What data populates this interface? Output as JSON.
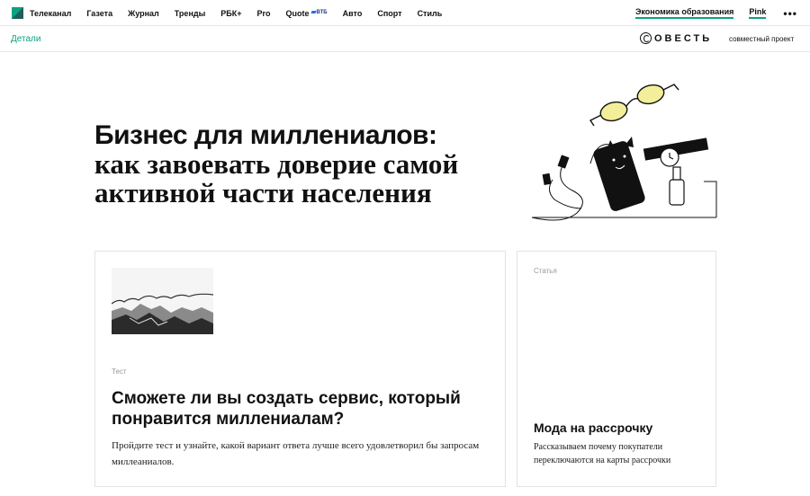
{
  "nav": {
    "items": [
      "Телеканал",
      "Газета",
      "Журнал",
      "Тренды",
      "РБК+",
      "Pro"
    ],
    "quote_label": "Quote",
    "quote_partner": "ВТБ",
    "items_after": [
      "Авто",
      "Спорт",
      "Стиль"
    ],
    "economy_link": "Экономика образования",
    "pink_link": "Pink",
    "more": "•••"
  },
  "subbar": {
    "details": "Детали",
    "partner_name": "ОВЕСТЬ",
    "joint_project": "совместный проект"
  },
  "hero": {
    "title_bold": "Бизнес для миллениалов:",
    "title_line2": "как завоевать доверие самой",
    "title_line3": "активной части населения"
  },
  "cards": {
    "test": {
      "tag": "Тест",
      "title": "Сможете ли вы создать сервис, который понравится миллениалам?",
      "description": "Пройдите тест и узнайте, какой вариант ответа лучше всего удовлетворил бы запросам миллеаниалов."
    },
    "article": {
      "tag": "Статья",
      "title": "Мода на рассрочку",
      "description": "Рассказываем почему покупатели переключаются на карты рассрочки"
    }
  },
  "colors": {
    "accent": "#0aa37f",
    "glasses_lens": "#f3ee9a",
    "text": "#111111",
    "muted": "#999999"
  }
}
